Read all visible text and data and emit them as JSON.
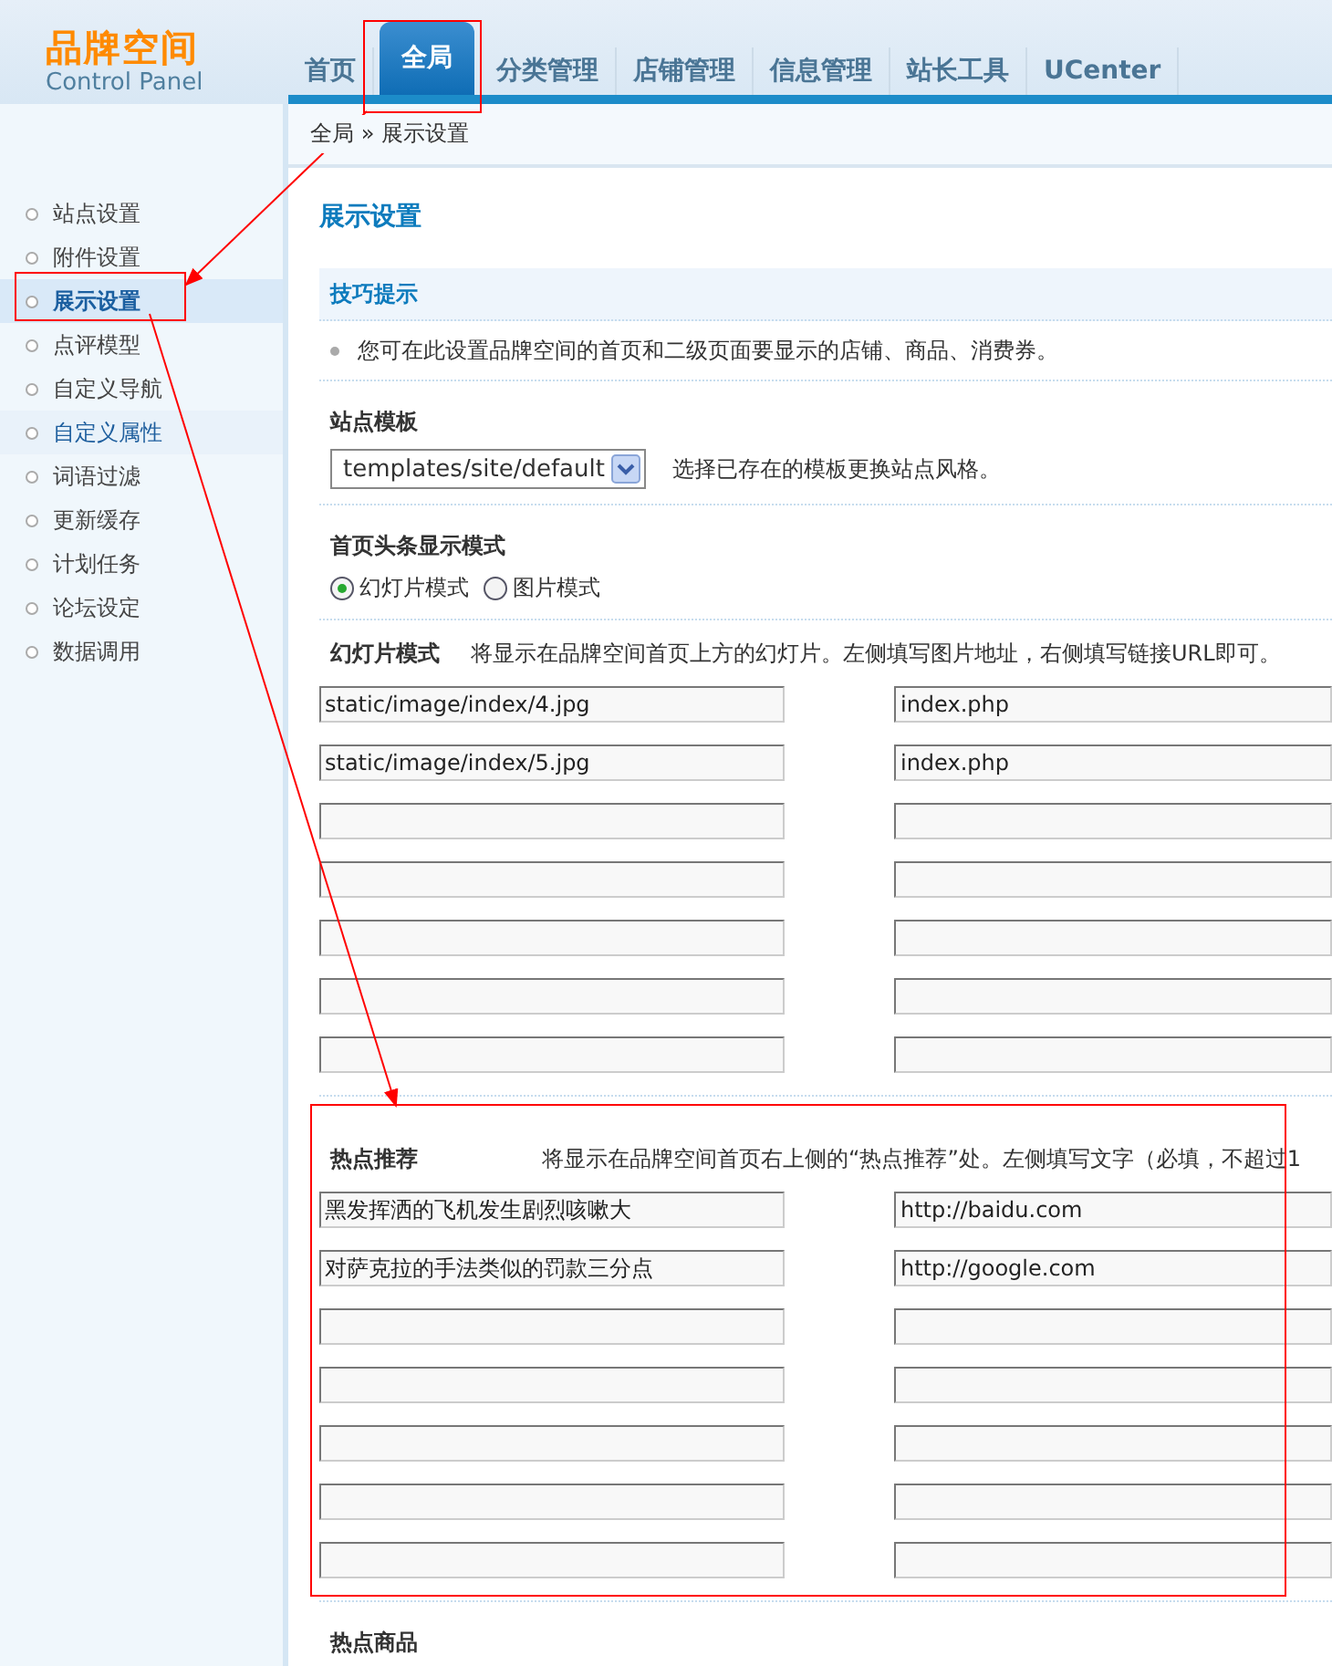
{
  "header": {
    "logo_title": "品牌空间",
    "logo_subtitle": "Control Panel",
    "tabs": [
      {
        "label": "首页",
        "selected": false
      },
      {
        "label": "全局",
        "selected": true
      },
      {
        "label": "分类管理",
        "selected": false
      },
      {
        "label": "店铺管理",
        "selected": false
      },
      {
        "label": "信息管理",
        "selected": false
      },
      {
        "label": "站长工具",
        "selected": false
      },
      {
        "label": "UCenter",
        "selected": false
      }
    ]
  },
  "breadcrumb": "全局 » 展示设置",
  "sidebar": {
    "items": [
      {
        "label": "站点设置",
        "selected": false,
        "highlighted": false
      },
      {
        "label": "附件设置",
        "selected": false,
        "highlighted": false
      },
      {
        "label": "展示设置",
        "selected": true,
        "highlighted": false
      },
      {
        "label": "点评模型",
        "selected": false,
        "highlighted": false
      },
      {
        "label": "自定义导航",
        "selected": false,
        "highlighted": false
      },
      {
        "label": "自定义属性",
        "selected": false,
        "highlighted": true
      },
      {
        "label": "词语过滤",
        "selected": false,
        "highlighted": false
      },
      {
        "label": "更新缓存",
        "selected": false,
        "highlighted": false
      },
      {
        "label": "计划任务",
        "selected": false,
        "highlighted": false
      },
      {
        "label": "论坛设定",
        "selected": false,
        "highlighted": false
      },
      {
        "label": "数据调用",
        "selected": false,
        "highlighted": false
      }
    ]
  },
  "page_title": "展示设置",
  "tips": {
    "title": "技巧提示",
    "items": [
      "您可在此设置品牌空间的首页和二级页面要显示的店铺、商品、消费券。"
    ]
  },
  "site_template": {
    "label": "站点模板",
    "value": "templates/site/default",
    "hint": "选择已存在的模板更换站点风格。"
  },
  "headline_mode": {
    "label": "首页头条显示模式",
    "options": [
      {
        "label": "幻灯片模式",
        "selected": true
      },
      {
        "label": "图片模式",
        "selected": false
      }
    ]
  },
  "slides": {
    "label": "幻灯片模式",
    "description": "将显示在品牌空间首页上方的幻灯片。左侧填写图片地址，右侧填写链接URL即可。",
    "rows": [
      {
        "left": "static/image/index/4.jpg",
        "right": "index.php"
      },
      {
        "left": "static/image/index/5.jpg",
        "right": "index.php"
      },
      {},
      {},
      {},
      {},
      {}
    ]
  },
  "hot": {
    "label": "热点推荐",
    "description": "将显示在品牌空间首页右上侧的“热点推荐”处。左侧填写文字（必填，不超过1",
    "rows": [
      {
        "left": "黑发挥洒的飞机发生剧烈咳嗽大",
        "right": "http://baidu.com"
      },
      {
        "left": "对萨克拉的手法类似的罚款三分点",
        "right": "http://google.com"
      },
      {},
      {},
      {},
      {},
      {}
    ]
  },
  "hot_goods": {
    "label": "热点商品"
  }
}
